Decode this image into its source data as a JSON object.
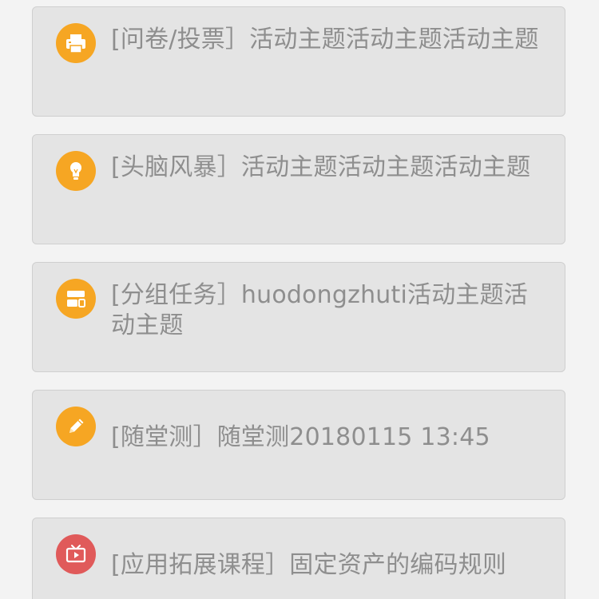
{
  "activities": [
    {
      "icon": "printer-icon",
      "icon_color": "#f6a623",
      "title": "[问卷/投票］活动主题活动主题活动主题"
    },
    {
      "icon": "lightbulb-icon",
      "icon_color": "#f6a623",
      "title": "[头脑风暴］活动主题活动主题活动主题"
    },
    {
      "icon": "group-layout-icon",
      "icon_color": "#f6a623",
      "title": "[分组任务］huodongzhuti活动主题活动主题"
    },
    {
      "icon": "pencil-icon",
      "icon_color": "#f6a623",
      "title": "[随堂测］随堂测20180115 13:45"
    },
    {
      "icon": "tv-play-icon",
      "icon_color": "#e05a5a",
      "title": "[应用拓展课程］固定资产的编码规则"
    }
  ]
}
